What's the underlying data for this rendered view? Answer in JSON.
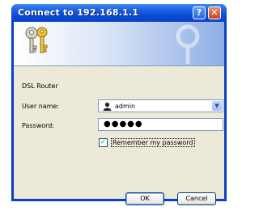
{
  "window": {
    "title": "Connect to 192.168.1.1",
    "help_label": "?",
    "close_label": "✕"
  },
  "dialog": {
    "realm": "DSL Router",
    "username_label": "User name:",
    "username_value": "admin",
    "password_label": "Password:",
    "password_value": "●●●●●",
    "remember_checked": true,
    "remember_label": "Remember my password",
    "ok_label": "OK",
    "cancel_label": "Cancel"
  }
}
